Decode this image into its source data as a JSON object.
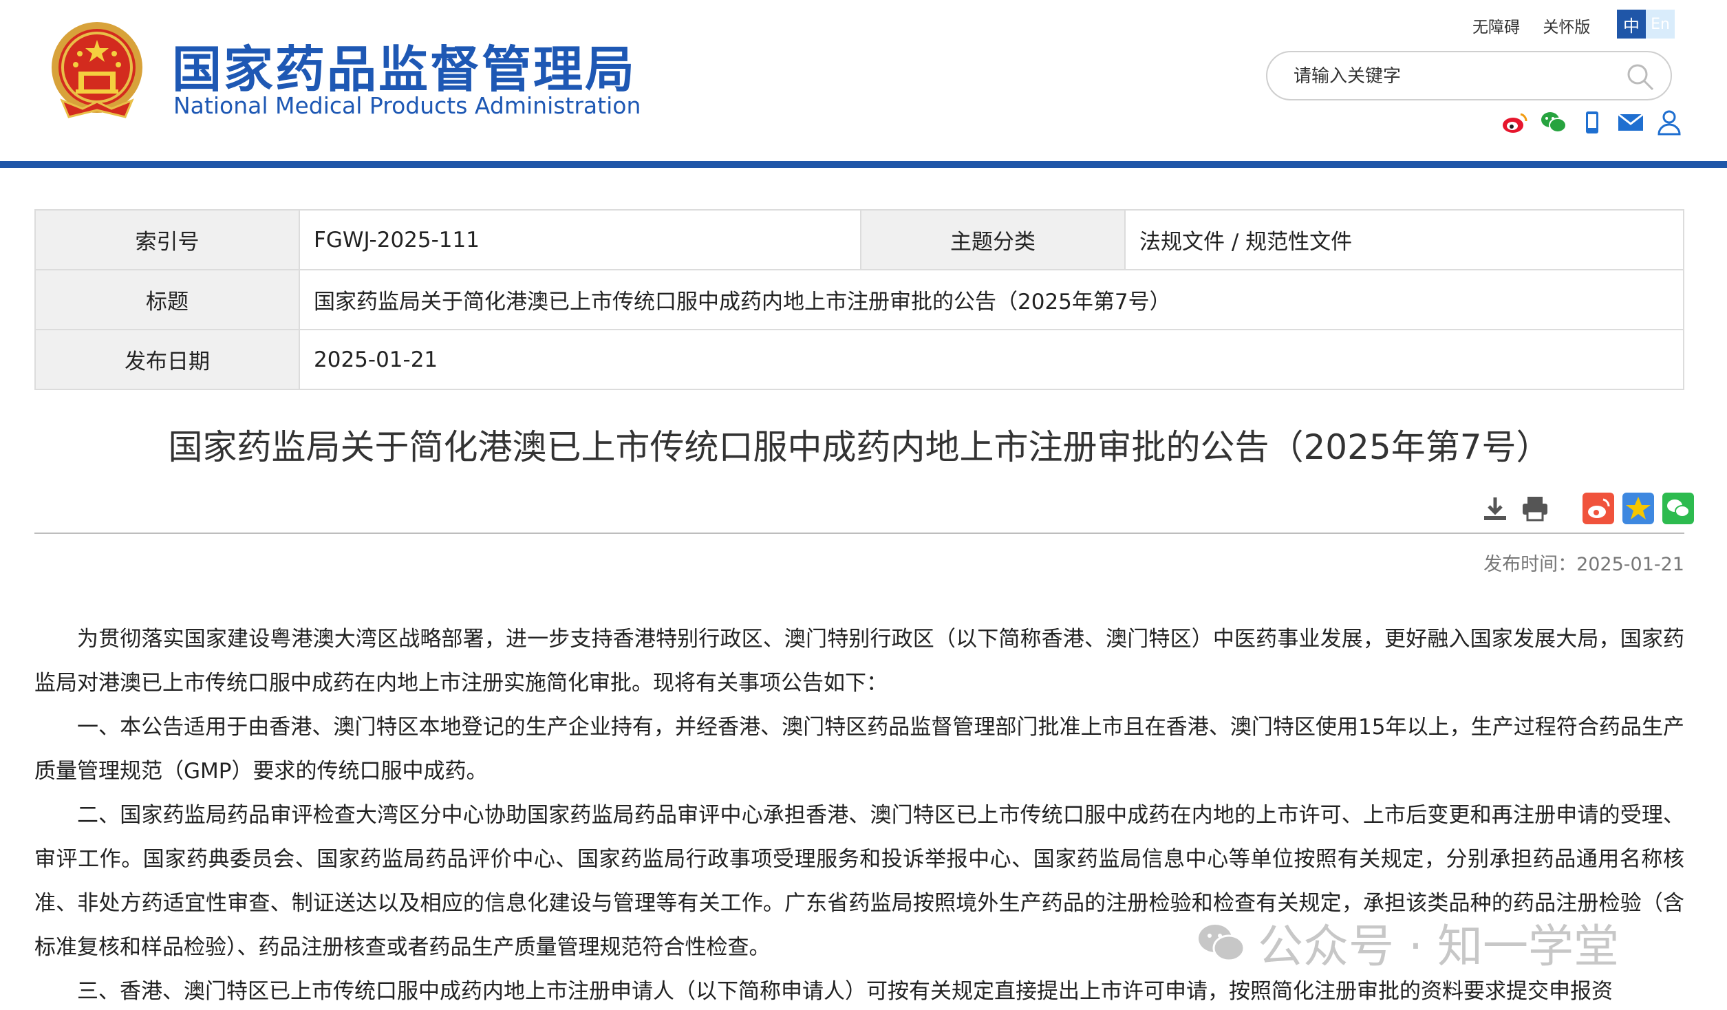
{
  "header": {
    "logo_cn": "国家药品监督管理局",
    "logo_en": "National Medical Products Administration",
    "top_links": [
      "无障碍",
      "关怀版"
    ],
    "lang_zh": "中",
    "lang_en": "En",
    "search_placeholder": "请输入关键字",
    "social_icons": [
      "weibo-icon",
      "wechat-icon",
      "mobile-icon",
      "mail-icon",
      "user-icon"
    ],
    "colors": {
      "brand_blue": "#1e58b4",
      "bar_blue": "#1f56a8"
    }
  },
  "info_table": {
    "index_label": "索引号",
    "index_value": "FGWJ-2025-111",
    "category_label": "主题分类",
    "category_value": "法规文件 / 规范性文件",
    "title_label": "标题",
    "title_value": "国家药监局关于简化港澳已上市传统口服中成药内地上市注册审批的公告（2025年第7号）",
    "date_label": "发布日期",
    "date_value": "2025-01-21"
  },
  "article": {
    "title": "国家药监局关于简化港澳已上市传统口服中成药内地上市注册审批的公告（2025年第7号）",
    "tool_icons": [
      "download-icon",
      "print-icon",
      "weibo-share-icon",
      "favorite-icon",
      "wechat-share-icon"
    ],
    "publish_time": "发布时间：2025-01-21",
    "paragraphs": [
      "为贯彻落实国家建设粤港澳大湾区战略部署，进一步支持香港特别行政区、澳门特别行政区（以下简称香港、澳门特区）中医药事业发展，更好融入国家发展大局，国家药监局对港澳已上市传统口服中成药在内地上市注册实施简化审批。现将有关事项公告如下：",
      "一、本公告适用于由香港、澳门特区本地登记的生产企业持有，并经香港、澳门特区药品监督管理部门批准上市且在香港、澳门特区使用15年以上，生产过程符合药品生产质量管理规范（GMP）要求的传统口服中成药。",
      "二、国家药监局药品审评检查大湾区分中心协助国家药监局药品审评中心承担香港、澳门特区已上市传统口服中成药在内地的上市许可、上市后变更和再注册申请的受理、审评工作。国家药典委员会、国家药监局药品评价中心、国家药监局行政事项受理服务和投诉举报中心、国家药监局信息中心等单位按照有关规定，分别承担药品通用名称核准、非处方药适宜性审查、制证送达以及相应的信息化建设与管理等有关工作。广东省药监局按照境外生产药品的注册检验和检查有关规定，承担该类品种的药品注册检验（含标准复核和样品检验）、药品注册核查或者药品生产质量管理规范符合性检查。",
      "三、香港、澳门特区已上市传统口服中成药内地上市注册申请人（以下简称申请人）可按有关规定直接提出上市许可申请，按照简化注册审批的资料要求提交申报资"
    ]
  },
  "watermark": {
    "text": "公众号 · 知一学堂"
  }
}
